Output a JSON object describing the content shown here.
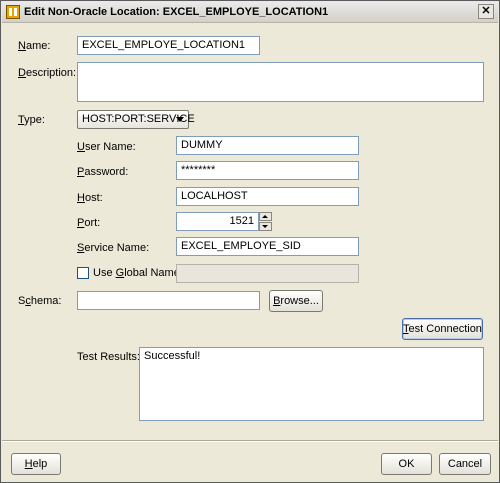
{
  "window": {
    "title": "Edit Non-Oracle Location: EXCEL_EMPLOYE_LOCATION1",
    "close_glyph": "✕"
  },
  "form": {
    "name_label": "Name:",
    "name_value": "EXCEL_EMPLOYE_LOCATION1",
    "description_label": "Description:",
    "description_value": "",
    "type_label": "Type:",
    "type_value": "HOST:PORT:SERVICE",
    "username_label": "User Name:",
    "username_value": "DUMMY",
    "password_label": "Password:",
    "password_value": "********",
    "host_label": "Host:",
    "host_value": "LOCALHOST",
    "port_label": "Port:",
    "port_value": "1521",
    "service_label": "Service Name:",
    "service_value": "EXCEL_EMPLOYE_SID",
    "global_name_label": "Use Global Name:",
    "global_name_value": "",
    "schema_label": "Schema:",
    "schema_value": "",
    "browse_label": "Browse...",
    "test_connection_label": "Test Connection",
    "test_results_label": "Test Results:",
    "test_results_value": "Successful!"
  },
  "footer": {
    "help_label": "Help",
    "ok_label": "OK",
    "cancel_label": "Cancel"
  },
  "icons": {
    "app": "owb-location-icon",
    "close": "close-icon",
    "dropdown": "chevron-down-icon",
    "spin_up": "arrow-up-icon",
    "spin_down": "arrow-down-icon"
  }
}
